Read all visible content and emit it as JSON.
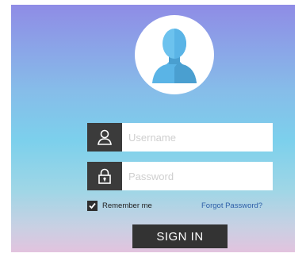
{
  "login": {
    "avatar_icon": "user-avatar-icon",
    "username": {
      "placeholder": "Username",
      "value": "",
      "icon": "user-icon"
    },
    "password": {
      "placeholder": "Password",
      "value": "",
      "icon": "lock-icon"
    },
    "remember_me": {
      "label": "Remember me",
      "checked": true
    },
    "forgot_password_label": "Forgot Password?",
    "sign_in_label": "SIGN IN"
  },
  "colors": {
    "gradient_top": "#8f8ce6",
    "gradient_mid": "#7cd0ec",
    "gradient_bottom": "#e2c3de",
    "avatar_blue": "#5ab4e6",
    "dark": "#333333",
    "link_blue": "#2d5fa8"
  }
}
